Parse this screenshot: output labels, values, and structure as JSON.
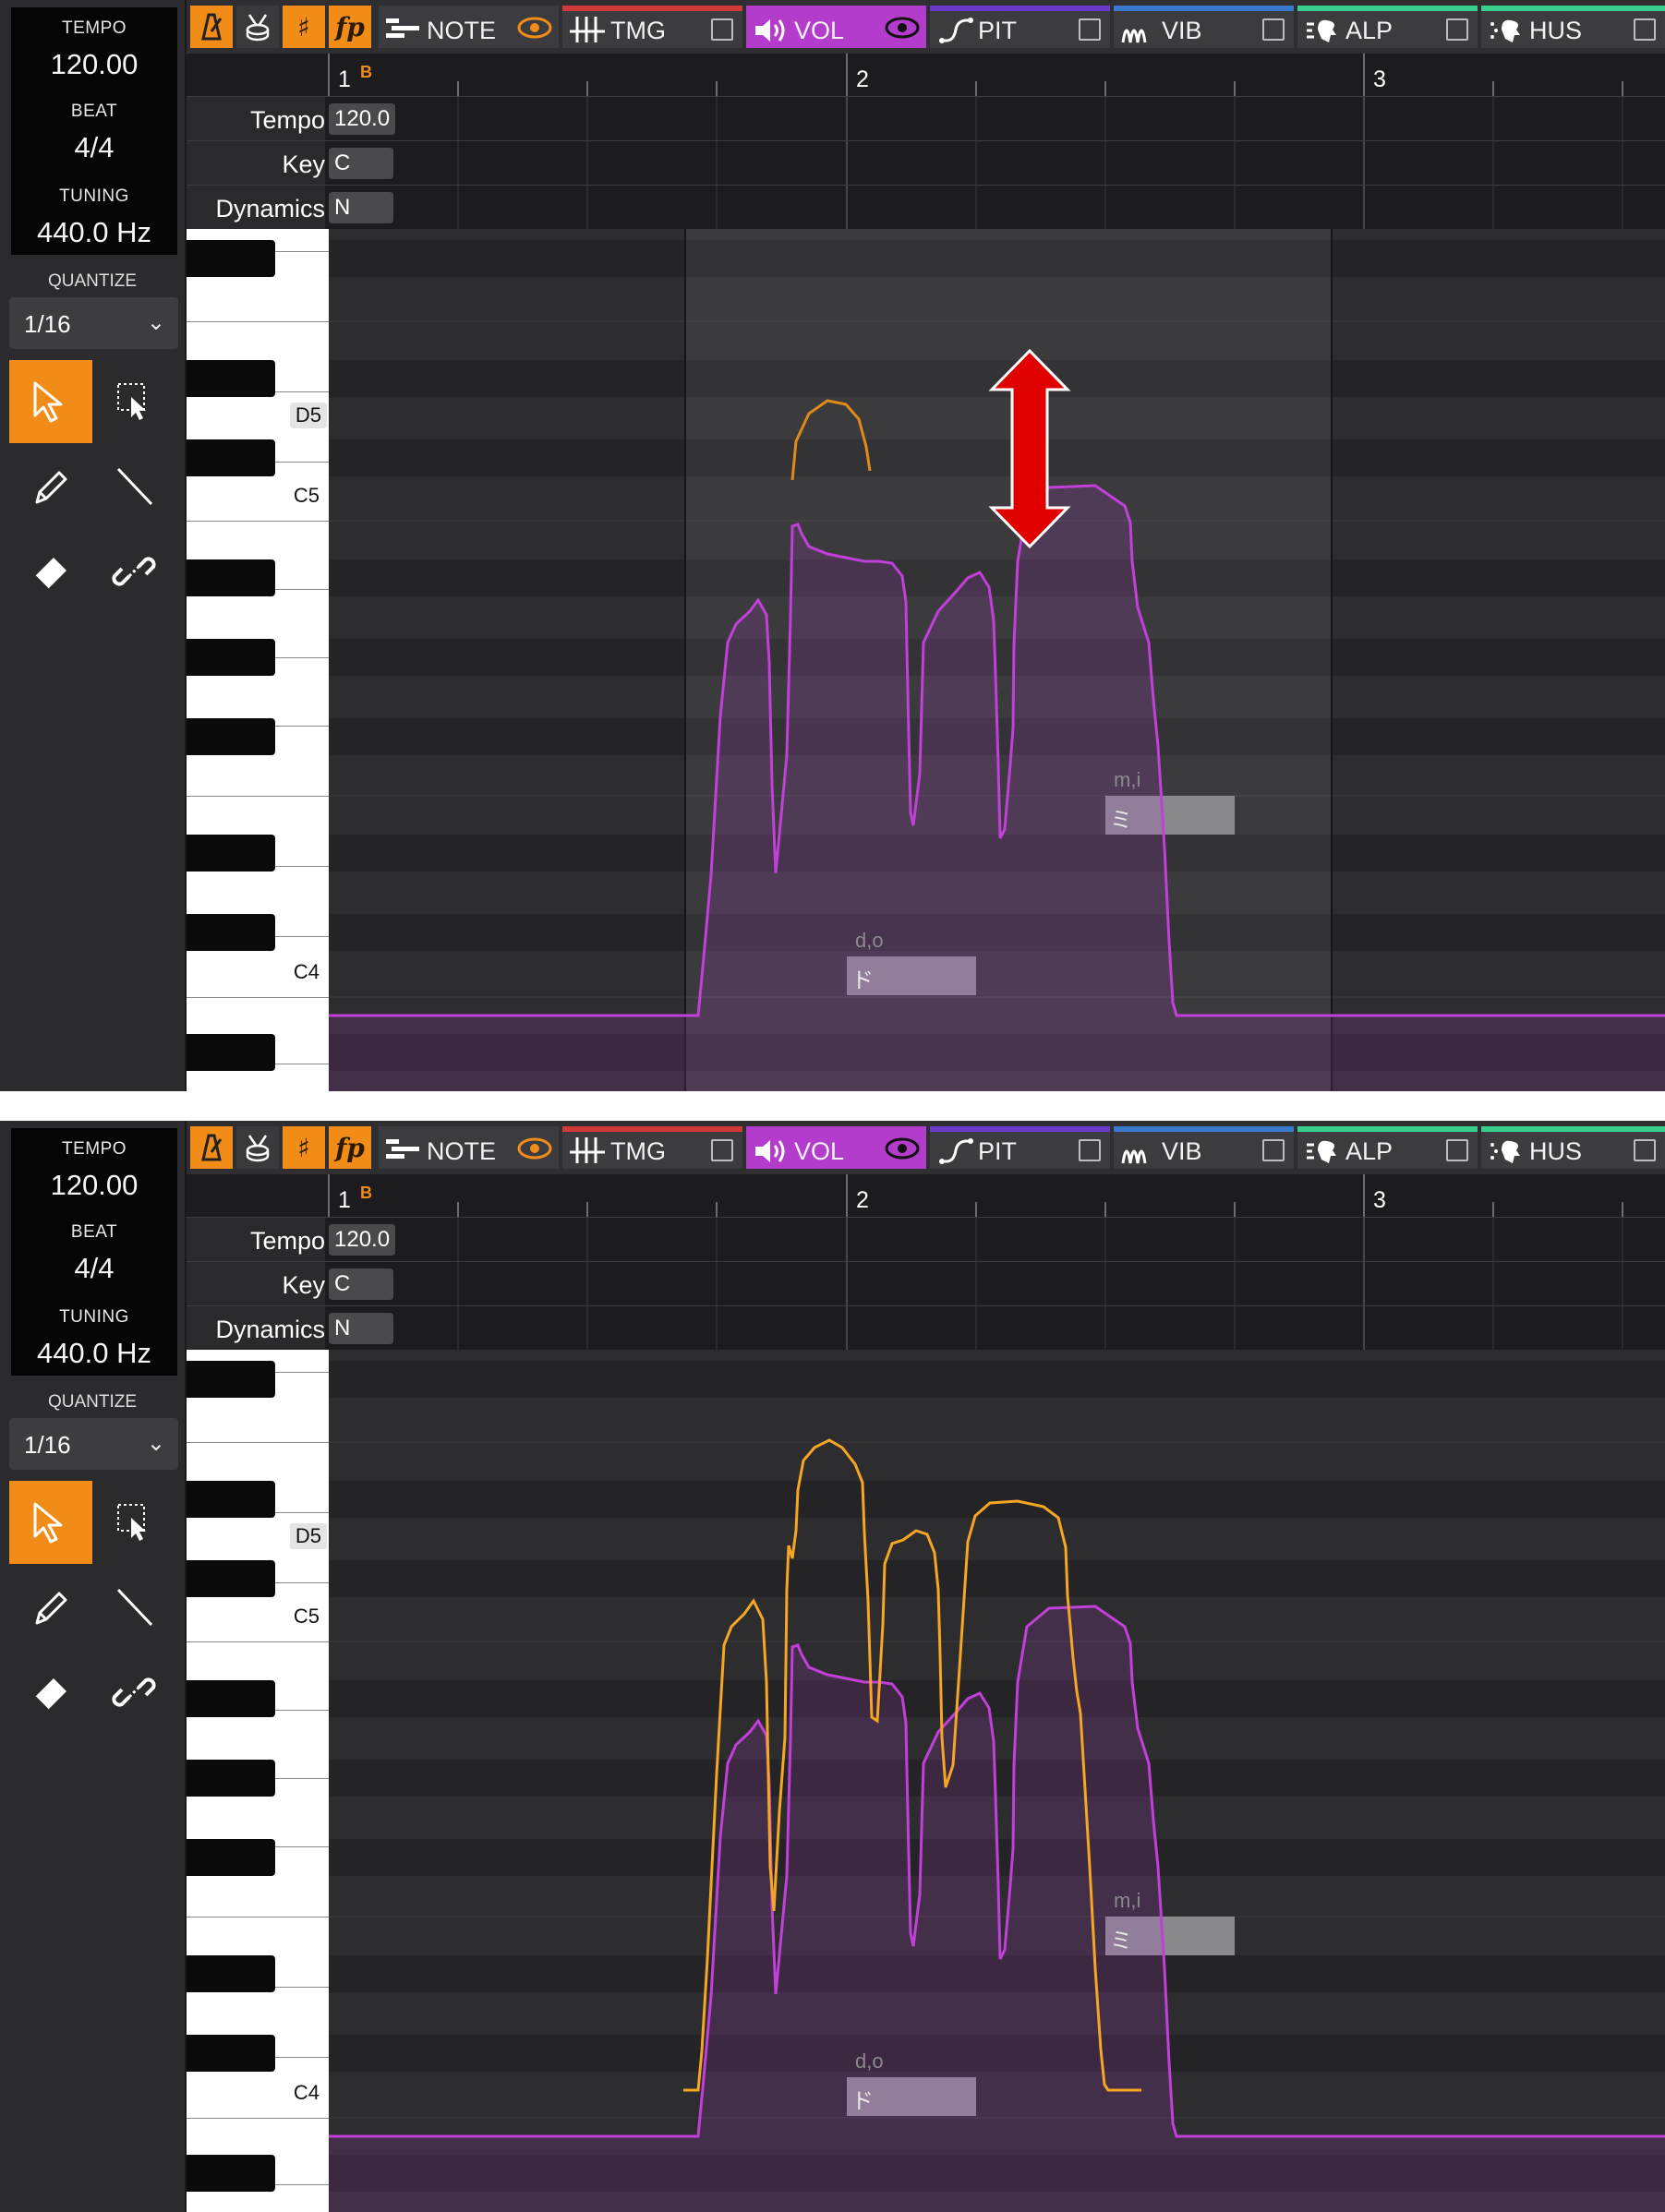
{
  "left_panel": {
    "tempo_label": "TEMPO",
    "tempo_value": "120.00",
    "beat_label": "BEAT",
    "beat_value": "4/4",
    "tuning_label": "TUNING",
    "tuning_value": "440.0 Hz",
    "quantize_label": "QUANTIZE",
    "quantize_value": "1/16",
    "tools": [
      "select-arrow-icon",
      "marquee-select-icon",
      "pencil-icon",
      "line-icon",
      "eraser-icon",
      "unlink-icon"
    ]
  },
  "toolbar": {
    "mode_icons": [
      "metronome-icon",
      "drum-icon",
      "pitch-symbol-icon",
      "dynamics-icon"
    ],
    "dynamics_glyph": "fp",
    "sharp_glyph": "♯",
    "tabs": [
      {
        "label": "NOTE",
        "color": "#3c3c40"
      },
      {
        "label": "TMG",
        "color": "#d23a3a"
      },
      {
        "label": "VOL",
        "color": "#b43ccd"
      },
      {
        "label": "PIT",
        "color": "#6a3acd"
      },
      {
        "label": "VIB",
        "color": "#3a7acd"
      },
      {
        "label": "ALP",
        "color": "#3acd8c"
      },
      {
        "label": "HUS",
        "color": "#3acd8c"
      }
    ]
  },
  "ruler": {
    "measures": [
      "1",
      "2",
      "3"
    ],
    "marker": "B"
  },
  "meta": {
    "tempo_label": "Tempo",
    "tempo_value": "120.0",
    "key_label": "Key",
    "key_value": "C",
    "dynamics_label": "Dynamics",
    "dynamics_value": "N"
  },
  "piano_labels": {
    "d5": "D5",
    "c5": "C5",
    "c4": "C4"
  },
  "notes": [
    {
      "lyric": "d,o",
      "glyph": "ド"
    },
    {
      "lyric": "m,i",
      "glyph": "ミ"
    }
  ],
  "colors": {
    "accent": "#f08c17",
    "volume_curve": "#c040d8",
    "edited_curve": "#f5a623",
    "arrow": "#e00000"
  }
}
